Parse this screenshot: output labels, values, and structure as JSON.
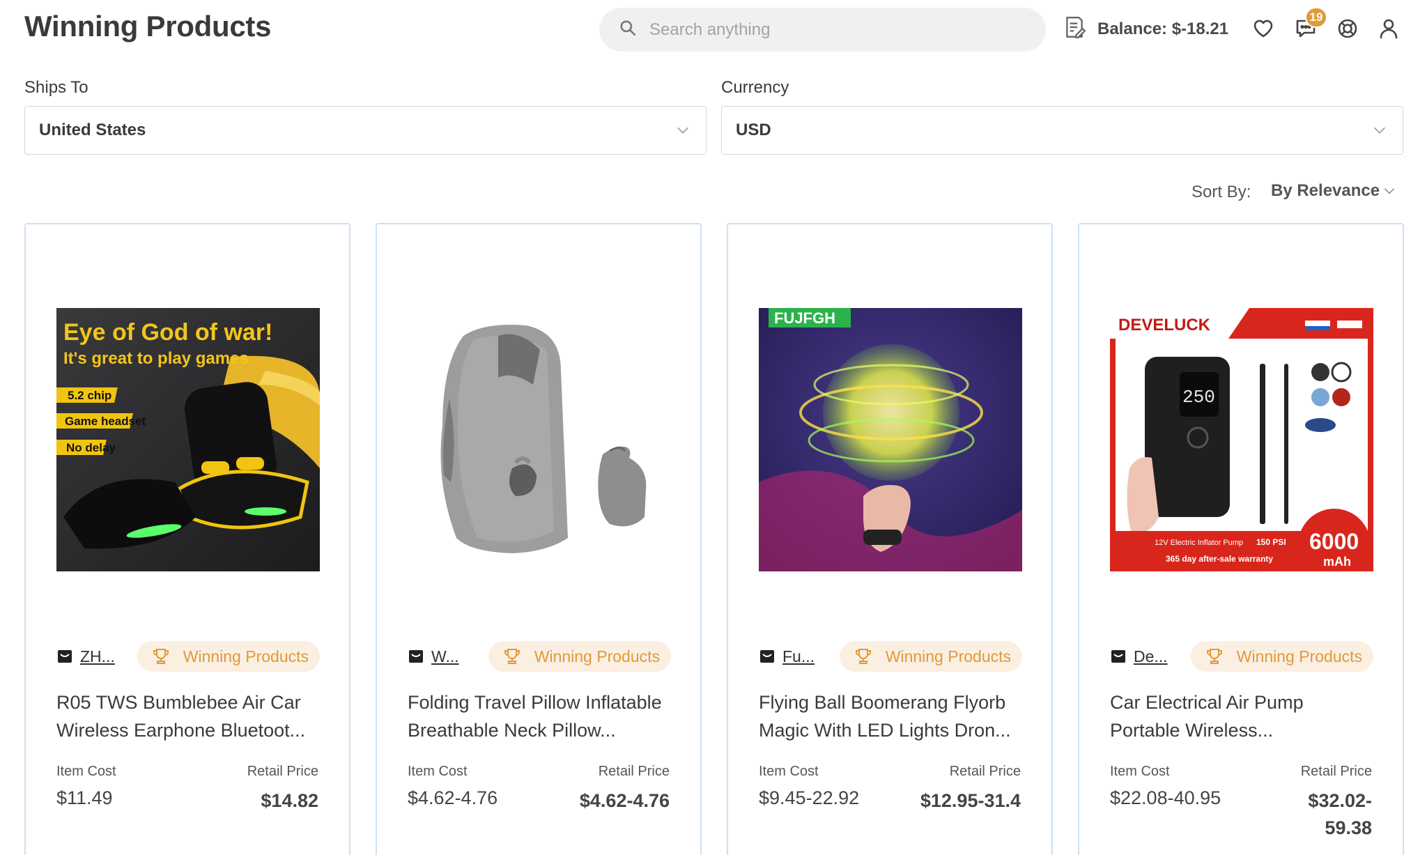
{
  "header": {
    "title": "Winning Products",
    "search_placeholder": "Search anything",
    "balance_label": "Balance: $-18.21",
    "notification_count": "19",
    "icons": [
      "orders-icon",
      "heart-icon",
      "chat-icon",
      "support-icon",
      "user-icon"
    ]
  },
  "filters": {
    "ships_to_label": "Ships To",
    "ships_to_value": "United States",
    "currency_label": "Currency",
    "currency_value": "USD"
  },
  "sort": {
    "label": "Sort By:",
    "value": "By Relevance"
  },
  "colors": {
    "accent": "#e09a3a",
    "badge_bg": "#fbefe2",
    "card_border": "#cfe0f2",
    "search_bg": "#f0f0f0"
  },
  "products": [
    {
      "store": "ZH...",
      "badge": "Winning Products",
      "title": "R05 TWS Bumblebee Air Car Wireless Earphone Bluetoot...",
      "cost_label": "Item Cost",
      "cost": "$11.49",
      "retail_label": "Retail Price",
      "retail": "$14.82",
      "image_text": [
        "Eye of God of war!",
        "It's great to play games",
        "5.2 chip",
        "Game headset",
        "No delay"
      ]
    },
    {
      "store": "W...",
      "badge": "Winning Products",
      "title": "Folding Travel Pillow Inflatable Breathable Neck Pillow...",
      "cost_label": "Item Cost",
      "cost": "$4.62-4.76",
      "retail_label": "Retail Price",
      "retail": "$4.62-4.76",
      "image_text": []
    },
    {
      "store": "Fu...",
      "badge": "Winning Products",
      "title": "Flying Ball Boomerang Flyorb Magic With LED Lights Dron...",
      "cost_label": "Item Cost",
      "cost": "$9.45-22.92",
      "retail_label": "Retail Price",
      "retail": "$12.95-31.4",
      "image_text": [
        "FUJFGH"
      ]
    },
    {
      "store": "De...",
      "badge": "Winning Products",
      "title": "Car Electrical Air Pump Portable Wireless...",
      "cost_label": "Item Cost",
      "cost": "$22.08-40.95",
      "retail_label": "Retail Price",
      "retail_line1": "$32.02-",
      "retail_line2": "59.38",
      "image_text": [
        "DEVELUCK",
        "12V Electric Inflator Pump",
        "150 PSI",
        "365 day after-sale warranty",
        "6000",
        "mAh",
        "250"
      ]
    }
  ]
}
